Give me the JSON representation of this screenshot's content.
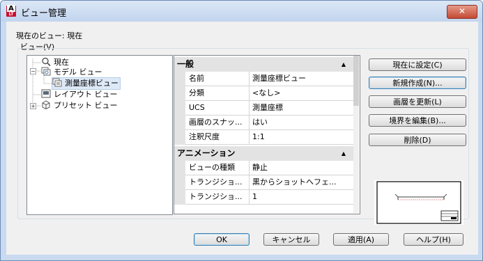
{
  "window": {
    "title": "ビュー管理",
    "app_icon": "autocad-icon",
    "close_label": "✕"
  },
  "current_view": {
    "label": "現在のビュー: 現在"
  },
  "views_label": "ビュー(V)",
  "tree": {
    "items": [
      {
        "label": "現在",
        "icon": "magnifier-icon"
      },
      {
        "label": "モデル ビュー",
        "icon": "model-view-icon",
        "expander": "−"
      },
      {
        "label": "測量座標ビュー",
        "icon": "named-view-icon",
        "selected": true
      },
      {
        "label": "レイアウト ビュー",
        "icon": "layout-view-icon"
      },
      {
        "label": "プリセット ビュー",
        "icon": "cube-icon",
        "expander": "+"
      }
    ]
  },
  "properties": {
    "general": {
      "title": "一般",
      "rows": [
        {
          "key": "名前",
          "value": "測量座標ビュー"
        },
        {
          "key": "分類",
          "value": "<なし>"
        },
        {
          "key": "UCS",
          "value": "測量座標"
        },
        {
          "key": "画層のスナッ...",
          "value": "はい"
        },
        {
          "key": "注釈尺度",
          "value": "1:1"
        }
      ]
    },
    "animation": {
      "title": "アニメーション",
      "rows": [
        {
          "key": "ビューの種類",
          "value": "静止"
        },
        {
          "key": "トランジショ...",
          "value": "黒からショットへフェ..."
        },
        {
          "key": "トランジショ...",
          "value": "1"
        }
      ]
    },
    "collapse_glyph": "▲"
  },
  "buttons": {
    "set_current": "現在に設定(C)",
    "new": "新規作成(N)...",
    "update_layers": "画層を更新(L)",
    "edit_boundaries": "境界を編集(B)...",
    "delete": "削除(D)",
    "ok": "OK",
    "cancel": "キャンセル",
    "apply": "適用(A)",
    "help": "ヘルプ(H)"
  },
  "colors": {
    "title_bar": "#c2d5ee",
    "close_button": "#c44a32",
    "autocad_red": "#c8102e"
  }
}
